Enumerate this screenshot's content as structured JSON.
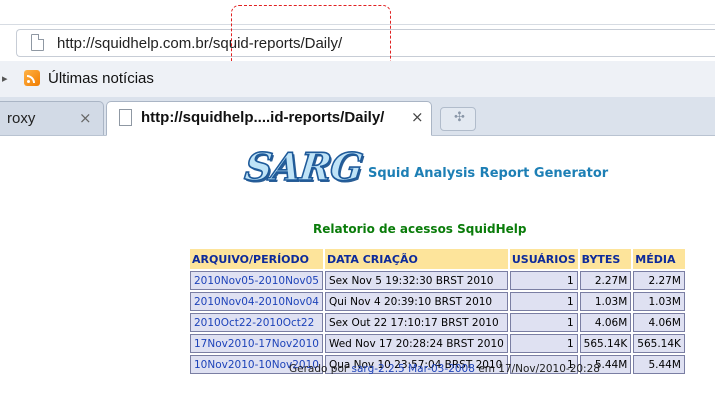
{
  "address_bar": {
    "url": "http://squidhelp.com.br/squid-reports/Daily/"
  },
  "bookmarks_bar": {
    "items": [
      {
        "label": "Últimas notícias",
        "icon": "rss-feed-icon"
      }
    ]
  },
  "tabs": [
    {
      "label": "roxy",
      "active": false
    },
    {
      "label": "http://squidhelp....id-reports/Daily/",
      "active": true
    }
  ],
  "icons": {
    "close": "×",
    "new_tab": "✣",
    "more": "▸"
  },
  "page": {
    "logo_text": "SARG",
    "app_title": "Squid Analysis Report Generator",
    "report_title": "Relatorio de acessos SquidHelp",
    "table": {
      "headers": [
        "ARQUIVO/PERÍODO",
        "DATA CRIAÇÃO",
        "USUÁRIOS",
        "BYTES",
        "MÉDIA"
      ],
      "rows": [
        {
          "periodo": "2010Nov05-2010Nov05",
          "data": "Sex Nov 5 19:32:30 BRST 2010",
          "usuarios": "1",
          "bytes": "2.27M",
          "media": "2.27M"
        },
        {
          "periodo": "2010Nov04-2010Nov04",
          "data": "Qui Nov 4 20:39:10 BRST 2010",
          "usuarios": "1",
          "bytes": "1.03M",
          "media": "1.03M"
        },
        {
          "periodo": "2010Oct22-2010Oct22",
          "data": "Sex Out 22 17:10:17 BRST 2010",
          "usuarios": "1",
          "bytes": "4.06M",
          "media": "4.06M"
        },
        {
          "periodo": "17Nov2010-17Nov2010",
          "data": "Wed Nov 17 20:28:24 BRST 2010",
          "usuarios": "1",
          "bytes": "565.14K",
          "media": "565.14K"
        },
        {
          "periodo": "10Nov2010-10Nov2010",
          "data": "Qua Nov 10 23:57:04 BRST 2010",
          "usuarios": "1",
          "bytes": "5.44M",
          "media": "5.44M"
        }
      ]
    },
    "footer": {
      "prefix": "Gerado por",
      "link": "sarg-2.2.5 Mar-03-2008",
      "suffix": "em 17/Nov/2010-20:28"
    }
  },
  "colors": {
    "header_bg": "#fde49b",
    "header_text": "#0d2a9a",
    "cell_bg": "#dfe1f2",
    "report_title": "#0a7c0a",
    "app_title": "#1d7fb5",
    "highlight_border": "#e02020"
  }
}
